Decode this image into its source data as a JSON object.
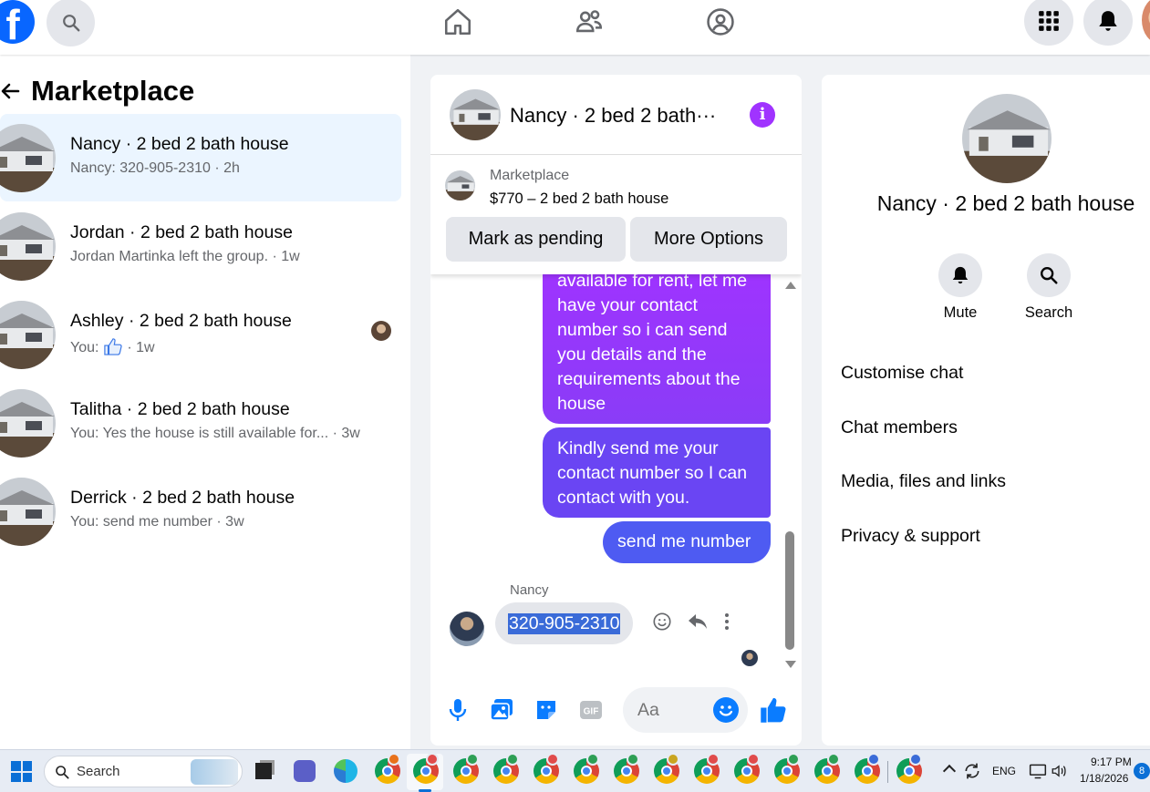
{
  "colors": {
    "facebook_blue": "#0866ff",
    "bubble_purple": "#a033ff",
    "bubble_blue": "#4e5bf2",
    "selection": "#3a6bd8"
  },
  "topbar": {
    "logo_letter": "f",
    "icons": [
      "search-icon",
      "home-icon",
      "friends-icon",
      "groups-icon",
      "apps-grid-icon",
      "notifications-icon"
    ]
  },
  "sidebar": {
    "title": "Marketplace",
    "conversations": [
      {
        "name": "Nancy · 2 bed 2 bath house",
        "preview": "Nancy: 320-905-2310 · 2h",
        "active": true
      },
      {
        "name": "Jordan · 2 bed 2 bath house",
        "preview": "Jordan Martinka left the group. · 1w",
        "active": false
      },
      {
        "name": "Ashley · 2 bed 2 bath house",
        "preview_prefix": "You:",
        "preview_suffix": "· 1w",
        "active": false
      },
      {
        "name": "Talitha · 2 bed 2 bath house",
        "preview": "You: Yes the house is still available for... · 3w",
        "active": false
      },
      {
        "name": "Derrick · 2 bed 2 bath house",
        "preview": "You: send me number · 3w",
        "active": false
      }
    ]
  },
  "chat": {
    "title": "Nancy · 2 bed 2 bath···",
    "marketplace": {
      "label": "Marketplace",
      "price_line": "$770 – 2 bed 2 bath house",
      "mark_pending": "Mark as pending",
      "more_options": "More Options"
    },
    "messages_sent": [
      "available for rent, let me have your contact number so i can send you details and the requirements about the house",
      "Kindly send me your contact number so I can contact with you.",
      "send me number"
    ],
    "received": {
      "sender": "Nancy",
      "text": "320-905-2310"
    },
    "composer": {
      "placeholder": "Aa"
    }
  },
  "details": {
    "title": "Nancy · 2 bed 2 bath house",
    "actions": [
      {
        "label": "Mute",
        "icon": "bell-icon"
      },
      {
        "label": "Search",
        "icon": "search-icon"
      }
    ],
    "menu": [
      "Customise chat",
      "Chat members",
      "Media, files and links",
      "Privacy & support"
    ]
  },
  "taskbar": {
    "search_label": "Search",
    "language": "ENG",
    "time": "9:17 PM",
    "date": "1/18/2026",
    "notification_count": "8"
  }
}
